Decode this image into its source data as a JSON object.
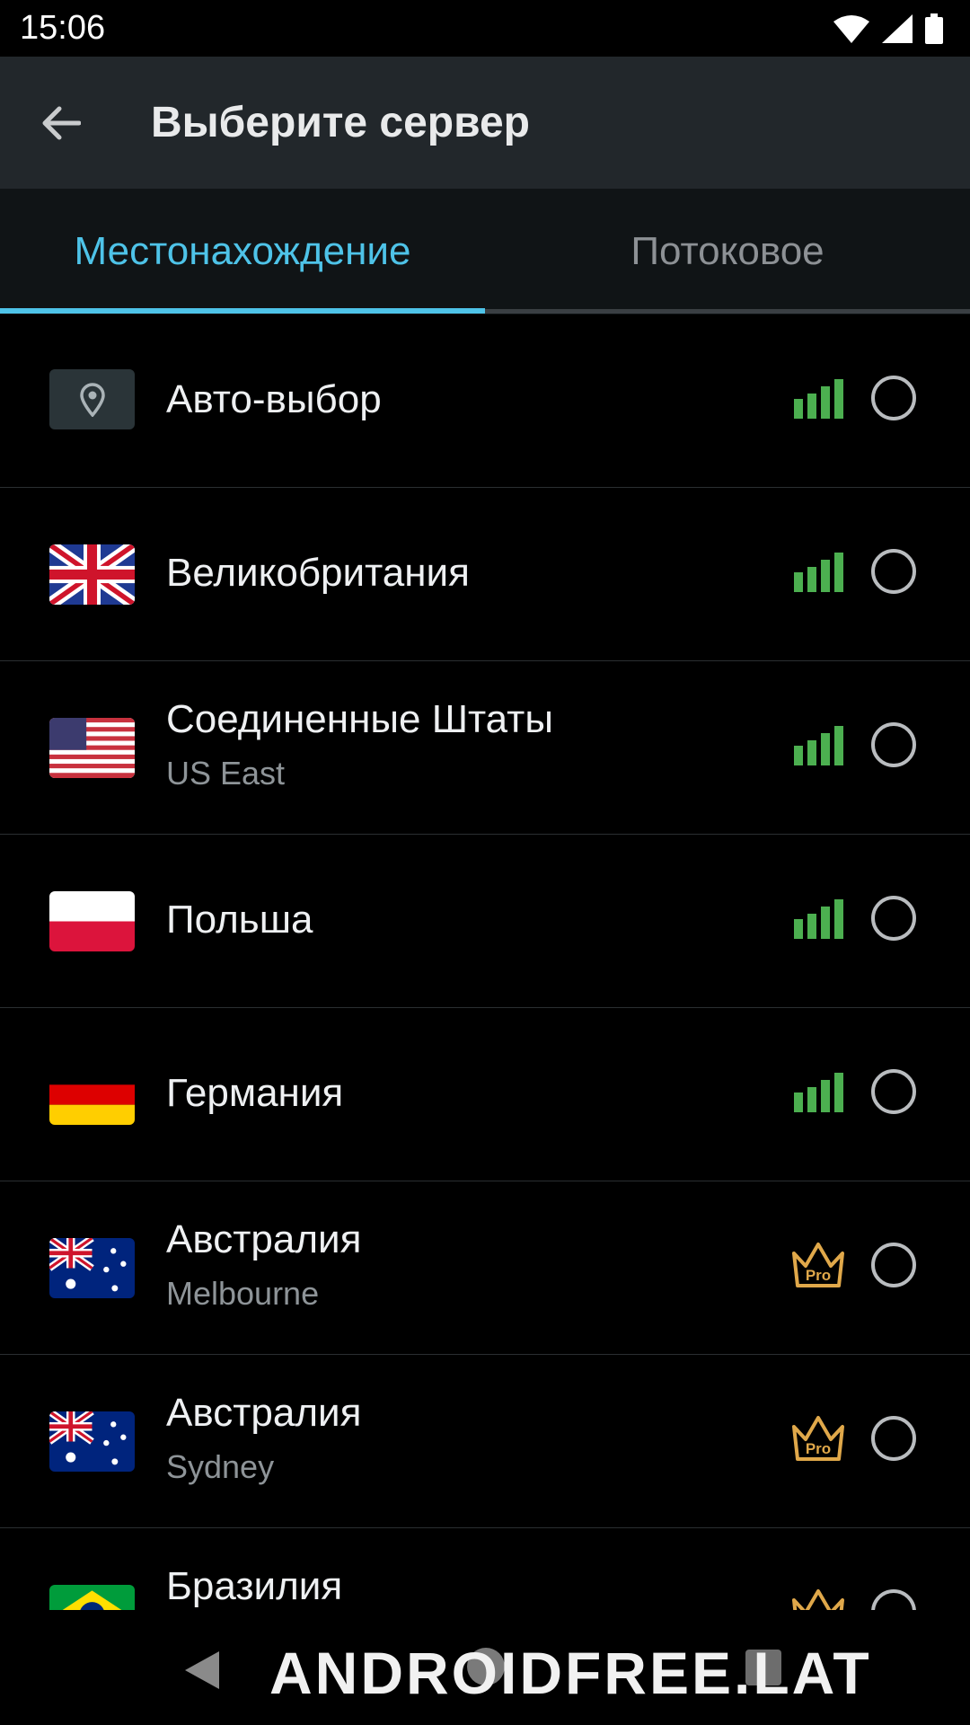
{
  "status_bar": {
    "time": "15:06"
  },
  "app_bar": {
    "title": "Выберите сервер"
  },
  "tabs": [
    {
      "label": "Местонахождение",
      "active": true
    },
    {
      "label": "Потоковое",
      "active": false
    }
  ],
  "servers": [
    {
      "title": "Авто-выбор",
      "subtitle": "",
      "icon": "location-pin-icon",
      "badge": "signal"
    },
    {
      "title": "Великобритания",
      "subtitle": "",
      "icon": "uk-flag-icon",
      "badge": "signal"
    },
    {
      "title": "Соединенные Штаты",
      "subtitle": "US East",
      "icon": "us-flag-icon",
      "badge": "signal"
    },
    {
      "title": "Польша",
      "subtitle": "",
      "icon": "poland-flag-icon",
      "badge": "signal"
    },
    {
      "title": "Германия",
      "subtitle": "",
      "icon": "germany-flag-icon",
      "badge": "signal"
    },
    {
      "title": "Австралия",
      "subtitle": "Melbourne",
      "icon": "australia-flag-icon",
      "badge": "pro"
    },
    {
      "title": "Австралия",
      "subtitle": "Sydney",
      "icon": "australia-flag-icon",
      "badge": "pro"
    },
    {
      "title": "Бразилия",
      "subtitle": "",
      "icon": "brazil-flag-icon",
      "badge": "pro"
    }
  ],
  "pro_badge_text": "Pro",
  "watermark": "ANDROIDFREE.LAT",
  "colors": {
    "accent": "#4ec3e8",
    "signal": "#4caf50",
    "pro": "#e0a84a",
    "app_bar": "#22272b"
  }
}
